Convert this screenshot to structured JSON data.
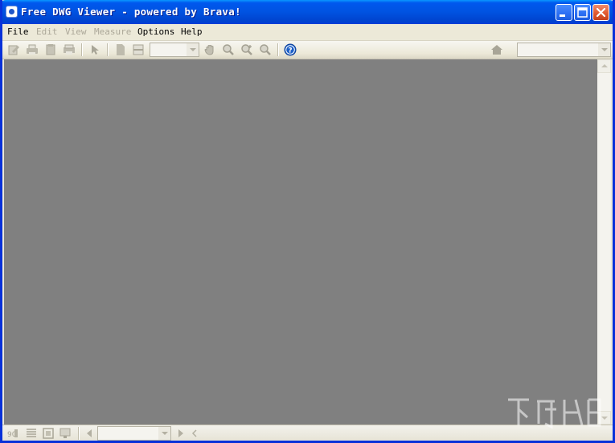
{
  "window": {
    "title": "Free DWG Viewer - powered by Brava!"
  },
  "menu": {
    "items": [
      {
        "label": "File",
        "enabled": true
      },
      {
        "label": "Edit",
        "enabled": false
      },
      {
        "label": "View",
        "enabled": false
      },
      {
        "label": "Measure",
        "enabled": false
      },
      {
        "label": "Options",
        "enabled": true
      },
      {
        "label": "Help",
        "enabled": true
      }
    ]
  },
  "toolbar": {
    "icons": [
      "markup-icon",
      "print-icon",
      "copy-icon",
      "print-preview-icon",
      "select-pointer-icon",
      "page-icon",
      "page-layout-icon",
      "pan-hand-icon",
      "zoom-window-icon",
      "zoom-realtime-icon",
      "zoom-fit-icon",
      "help-icon",
      "home-icon"
    ],
    "zoom_combo_value": "",
    "view_combo_value": ""
  },
  "canvas": {
    "background": "#808080"
  },
  "bottombar": {
    "icons": [
      "layers-icon",
      "list-icon",
      "thumbnail-icon",
      "monitor-icon",
      "prev-page-icon",
      "next-page-icon",
      "prev-icon"
    ],
    "page_combo_value": ""
  },
  "colors": {
    "titlebar": "#0054e3",
    "canvas": "#808080",
    "chrome": "#ece9d8",
    "help_blue": "#1c5fc7"
  }
}
